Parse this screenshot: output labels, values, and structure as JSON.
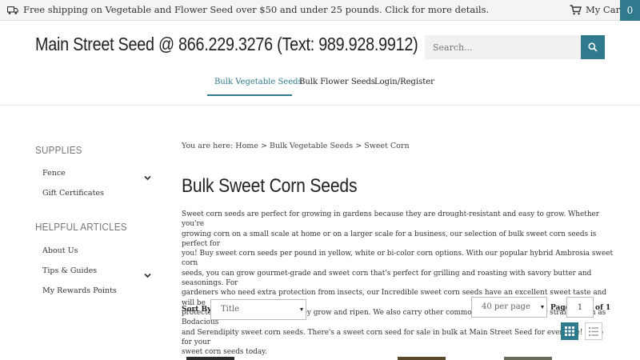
{
  "topbar": {
    "promo": "Free shipping on Vegetable and Flower Seed over $50 and under 25 pounds. Click for more details.",
    "cart_label": "My Cart",
    "cart_count": "0"
  },
  "header": {
    "site_title": "Main Street Seed @ 866.229.3276 (Text: 989.928.9912)",
    "search_placeholder": "Search..."
  },
  "nav": {
    "items": [
      "Bulk Vegetable Seeds",
      "Bulk Flower Seeds",
      "Login/Register"
    ],
    "active_index": 0
  },
  "sidebar": {
    "sections": [
      {
        "heading": "SUPPLIES",
        "items": [
          "Fence",
          "Gift Certificates"
        ]
      },
      {
        "heading": "HELPFUL ARTICLES",
        "items": [
          "About Us",
          "Tips & Guides",
          "My Rewards Points"
        ]
      }
    ]
  },
  "breadcrumb": {
    "prefix": "You are here:",
    "items": [
      "Home",
      "Bulk Vegetable Seeds",
      "Sweet Corn"
    ],
    "separator": ">"
  },
  "main": {
    "title": "Bulk Sweet Corn Seeds",
    "description": [
      "Sweet corn seeds are perfect for growing in gardens because they are drought-resistant and easy to grow. Whether you're",
      "growing corn on a small scale at home or on a larger scale for a business, our selection of bulk sweet corn seeds is perfect for",
      "you! Buy sweet corn seeds per pound in yellow, white or bi-color corn options. With our popular hybrid Ambrosia sweet corn",
      "seeds, you can grow gourmet-grade and sweet corn that's perfect for grilling and roasting with savory butter and seasonings. For",
      "gardeners who need extra protection from insects, our Incredible sweet corn seeds have an excellent sweet taste and will be",
      "protected by a durable husk as they grow and ripen. We also carry other commonly used and popular strains, such as Bodacious",
      "and Serendipity sweet corn seeds. There's a sweet corn seed for sale in bulk at Main Street Seed for everyone! Shop for your",
      "sweet corn seeds today."
    ]
  },
  "toolbar": {
    "sort_label": "Sort By:",
    "sort_value": "Title",
    "per_page": "40 per page",
    "page_label": "Page",
    "page_value": "1",
    "page_of": "of 1"
  },
  "colors": {
    "accent": "#2f7a8c",
    "topbar_bg": "#f4f4f4"
  }
}
